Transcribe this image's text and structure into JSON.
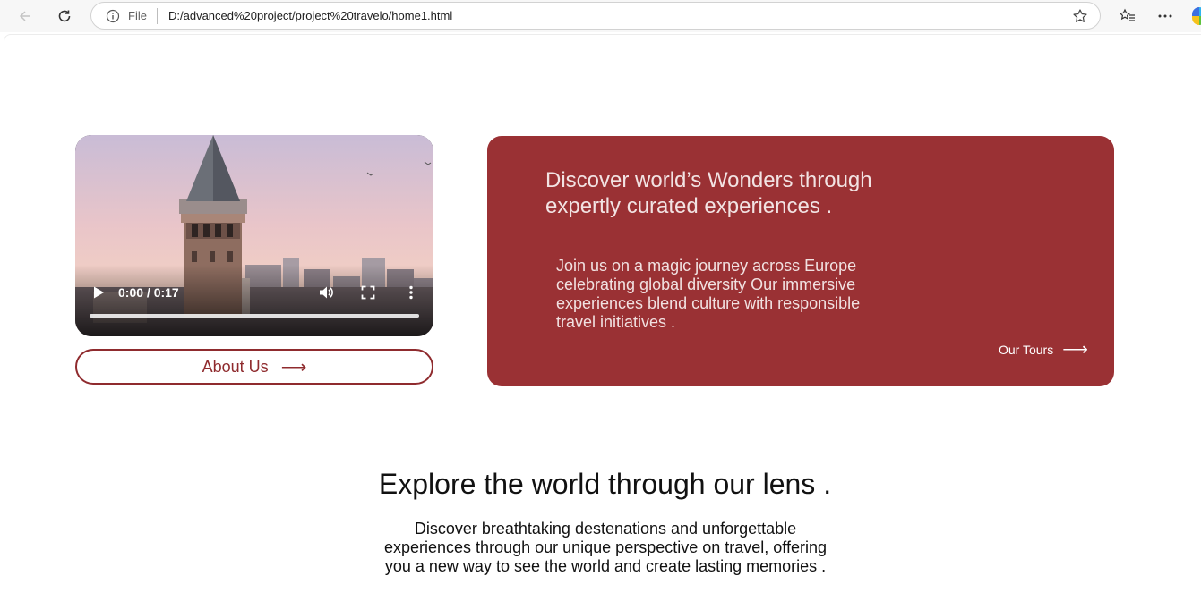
{
  "browser": {
    "file_label": "File",
    "url": "D:/advanced%20project/project%20travelo/home1.html",
    "icons": [
      "back-arrow-icon",
      "reload-icon",
      "info-icon",
      "star-icon",
      "favorites-icon",
      "more-icon",
      "edge-copilot-icon"
    ]
  },
  "video": {
    "time": "0:00 / 0:17",
    "progress": 0
  },
  "about": {
    "label": "About Us",
    "arrow": "⟶"
  },
  "card": {
    "title": "Discover world’s Wonders through expertly curated experiences .",
    "text": "Join us on a magic journey across Europe celebrating global diversity Our immersive experiences blend culture with responsible travel initiatives .",
    "tours_label": "Our Tours",
    "arrow": "⟶",
    "color": "#9a3134"
  },
  "section": {
    "title": "Explore the world through our lens .",
    "text": "Discover breathtaking destenations and unforgettable experiences through our unique perspective on travel, offering you a new way to see the world and create lasting memories ."
  },
  "colors": {
    "accent": "#8f2b2e"
  }
}
